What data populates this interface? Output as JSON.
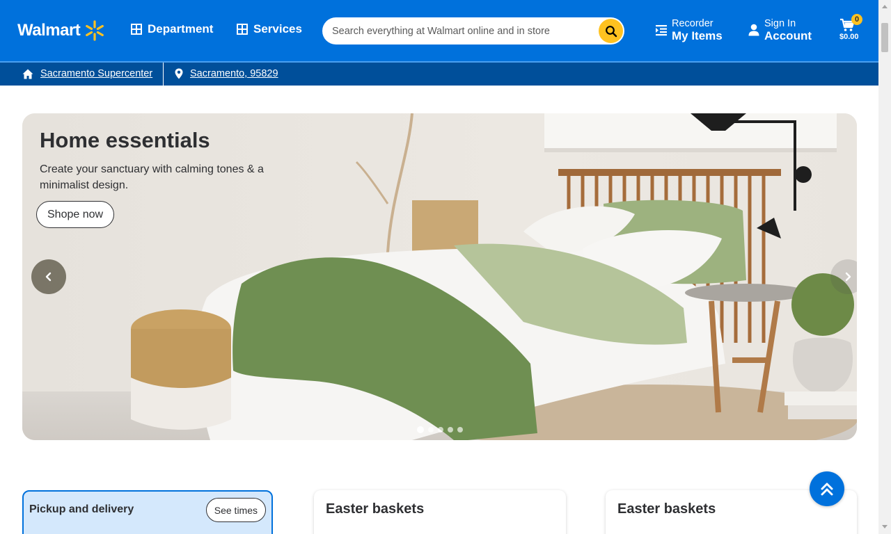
{
  "header": {
    "logo_text": "Walmart",
    "department_label": "Department",
    "services_label": "Services",
    "search_placeholder": "Search everything at Walmart online and in store",
    "reorder_small": "Recorder",
    "reorder_big": "My Items",
    "account_small": "Sign In",
    "account_big": "Account",
    "cart_count": "0",
    "cart_total": "$0.00",
    "colors": {
      "brand_blue": "#0071dc",
      "accent_yellow": "#ffc220",
      "location_bar": "#004f9a"
    }
  },
  "location_bar": {
    "store": "Sacramento Supercenter",
    "zip": "Sacramento, 95829"
  },
  "hero": {
    "title": "Home essentials",
    "subtitle": "Create your sanctuary with calming tones & a minimalist design.",
    "cta": "Shope now",
    "carousel_slide": 1,
    "carousel_total": 5
  },
  "cards": {
    "pickup_title": "Pickup and delivery",
    "pickup_button": "See times",
    "card2_title": "Easter baskets",
    "card3_title": "Easter baskets"
  },
  "icons": [
    "spark-logo-icon",
    "grid-icon",
    "search-icon",
    "reorder-icon",
    "user-icon",
    "cart-icon",
    "home-icon",
    "location-pin-icon",
    "chevron-left-icon",
    "chevron-right-icon",
    "double-chevron-up-icon"
  ]
}
